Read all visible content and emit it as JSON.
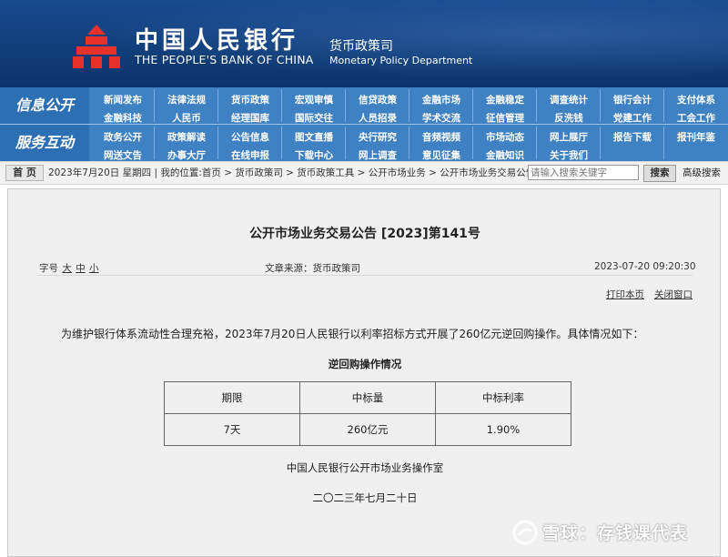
{
  "banner": {
    "bank_name_cn": "中国人民银行",
    "bank_name_en": "THE PEOPLE'S BANK OF CHINA",
    "dept_cn": "货币政策司",
    "dept_en": "Monetary Policy Department",
    "logo_color": "#e6322a"
  },
  "nav": {
    "group1_label": "信息公开",
    "group2_label": "服务互动",
    "rows": [
      [
        "新闻发布",
        "法律法规",
        "货币政策",
        "宏观审慎",
        "信贷政策",
        "金融市场",
        "金融稳定",
        "调查统计",
        "银行会计",
        "支付体系"
      ],
      [
        "金融科技",
        "人民币",
        "经理国库",
        "国际交往",
        "人员招录",
        "学术交流",
        "征信管理",
        "反洗钱",
        "党建工作",
        "工会工作"
      ],
      [
        "政务公开",
        "政策解读",
        "公告信息",
        "图文直播",
        "央行研究",
        "音频视频",
        "市场动态",
        "网上展厅",
        "报告下载",
        "报刊年鉴"
      ],
      [
        "网送文告",
        "办事大厅",
        "在线申报",
        "下载中心",
        "网上调查",
        "意见征集",
        "金融知识",
        "关于我们",
        "",
        ""
      ]
    ]
  },
  "breadcrumb": {
    "home_label": "首 页",
    "text": "2023年7月20日 星期四 | 我的位置:首页 > 货币政策司 > 货币政策工具 > 公开市场业务 > 公开市场业务交易公告",
    "search_placeholder": "请输入搜索关键字",
    "search_button": "搜索",
    "advanced_search": "高级搜索"
  },
  "article": {
    "title": "公开市场业务交易公告 [2023]第141号",
    "font_size_label": "字号",
    "font_large": "大",
    "font_medium": "中",
    "font_small": "小",
    "source": "文章来源：货币政策司",
    "datetime": "2023-07-20 09:20:30",
    "print_label": "打印本页",
    "close_label": "关闭窗口",
    "paragraph": "为维护银行体系流动性合理充裕，2023年7月20日人民银行以利率招标方式开展了260亿元逆回购操作。具体情况如下：",
    "table_title": "逆回购操作情况",
    "table": {
      "headers": [
        "期限",
        "中标量",
        "中标利率"
      ],
      "rows": [
        [
          "7天",
          "260亿元",
          "1.90%"
        ]
      ]
    },
    "sign_org": "中国人民银行公开市场业务操作室",
    "sign_date": "二〇二三年七月二十日"
  },
  "watermark": {
    "text": "雪球：存钱课代表"
  }
}
